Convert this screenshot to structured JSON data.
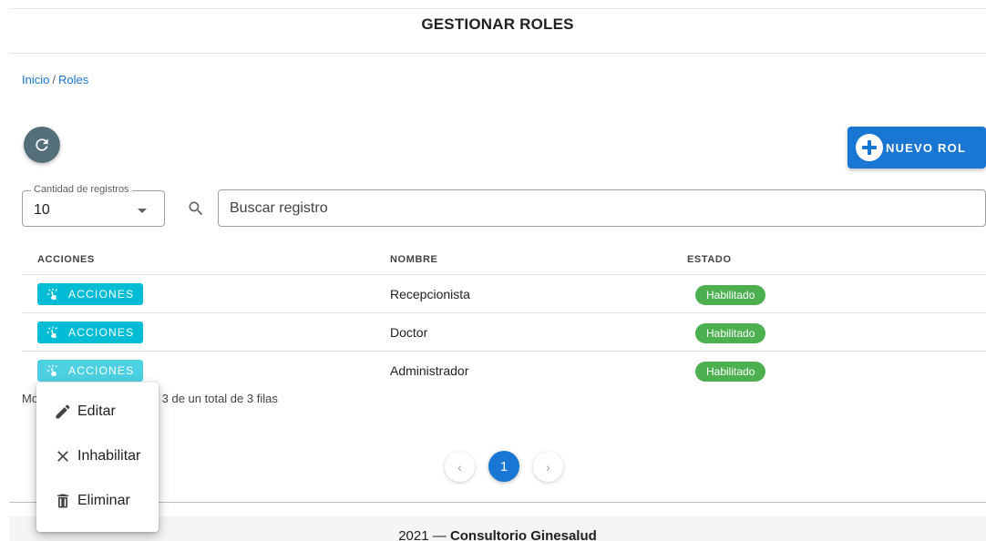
{
  "header": {
    "title": "GESTIONAR ROLES"
  },
  "breadcrumb": {
    "home": "Inicio",
    "separator": "/",
    "current": "Roles"
  },
  "toolbar": {
    "refresh_icon": "refresh-icon",
    "new_button_label": "NUEVO ROL",
    "new_button_icon": "plus-circle-icon"
  },
  "filters": {
    "records_label": "Cantidad de registros",
    "records_value": "10",
    "search_placeholder": "Buscar registro"
  },
  "table": {
    "headers": [
      "ACCIONES",
      "NOMBRE",
      "ESTADO"
    ],
    "action_label": "ACCIONES",
    "rows": [
      {
        "name": "Recepcionista",
        "status": "Habilitado"
      },
      {
        "name": "Doctor",
        "status": "Habilitado"
      },
      {
        "name": "Administrador",
        "status": "Habilitado"
      }
    ]
  },
  "info": {
    "prefix_visible": "Mo",
    "suffix_visible": "1 al 3 de un total de 3 filas"
  },
  "pagination": {
    "current_page": "1",
    "prev": "‹",
    "next": "›"
  },
  "context_menu": {
    "items": [
      {
        "label": "Editar",
        "icon": "pencil-icon"
      },
      {
        "label": "Inhabilitar",
        "icon": "close-icon"
      },
      {
        "label": "Eliminar",
        "icon": "trash-icon"
      }
    ]
  },
  "footer": {
    "year": "2021",
    "dash": "—",
    "brand": "Consultorio Ginesalud"
  },
  "colors": {
    "primary": "#1976d2",
    "info": "#00bcd4",
    "success": "#4caf50",
    "refresh": "#546e7a"
  }
}
